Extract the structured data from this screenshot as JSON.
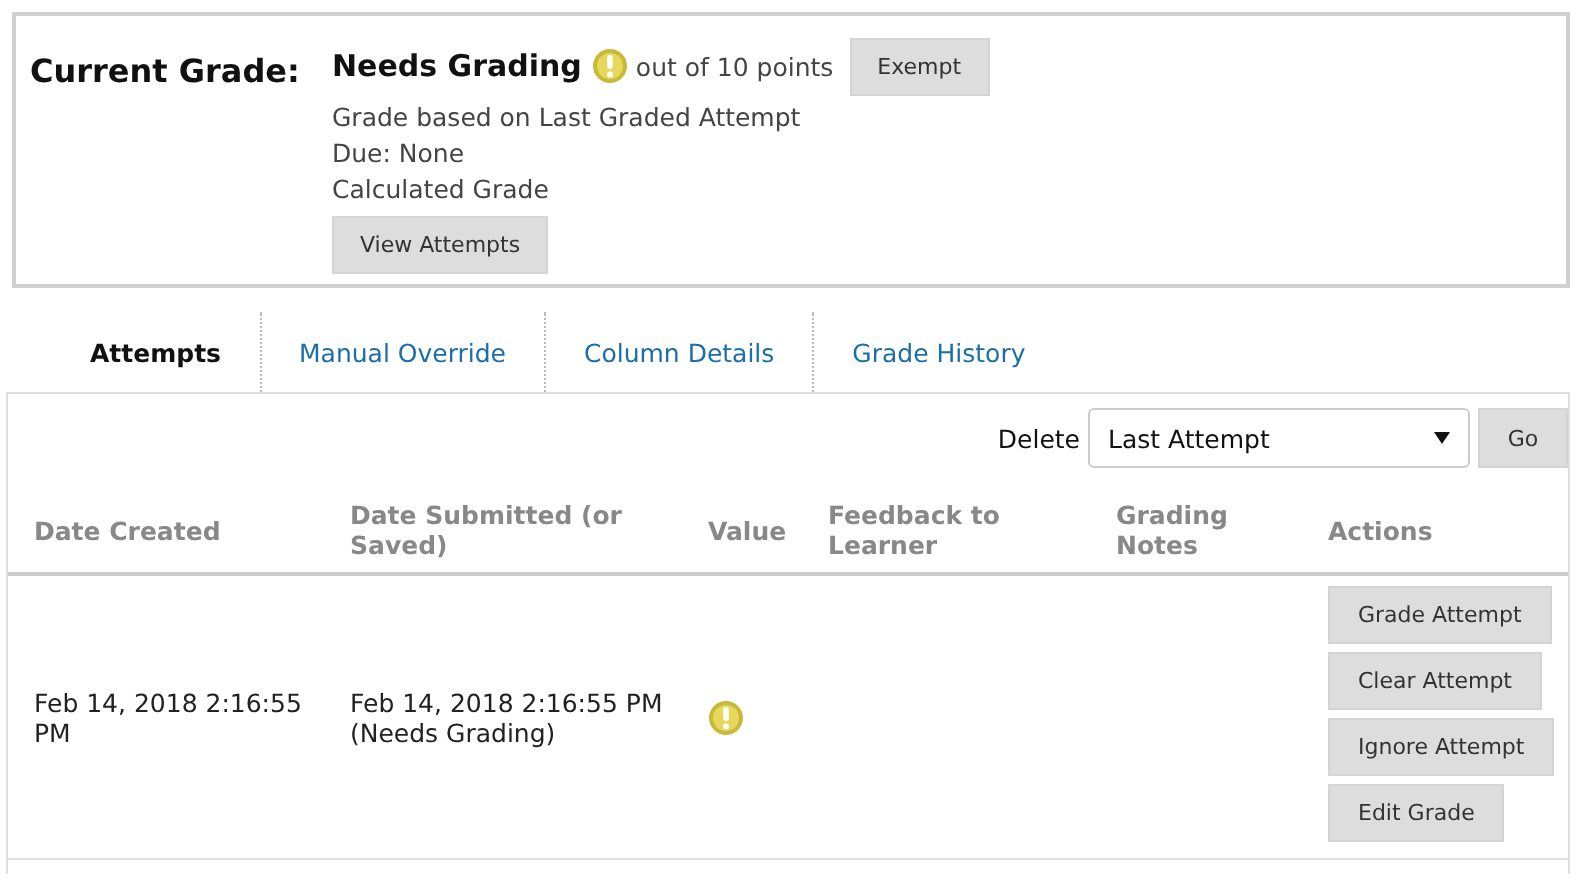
{
  "current_grade": {
    "label": "Current Grade:",
    "status": "Needs Grading",
    "status_icon": {
      "kind": "needs_grading"
    },
    "points": "out of 10 points",
    "exempt_button": "Exempt",
    "details": [
      "Grade based on Last Graded Attempt",
      "Due: None",
      "Calculated Grade"
    ],
    "view_button": "View Attempts"
  },
  "tabs": [
    {
      "label": "Attempts",
      "selected": true
    },
    {
      "label": "Manual Override",
      "selected": false
    },
    {
      "label": "Column Details",
      "selected": false
    },
    {
      "label": "Grade History",
      "selected": false
    }
  ],
  "delete": {
    "label": "Delete",
    "value": "Last Attempt",
    "button": "Go"
  },
  "table": {
    "columns": [
      "Date Created",
      "Date Submitted (or Saved)",
      "Value",
      "Feedback to Learner",
      "Grading Notes",
      "Actions"
    ],
    "rows": [
      {
        "date_created": "Feb 14, 2018 2:16:55 PM",
        "date_submitted": "Feb 14, 2018 2:16:55 PM",
        "submitted_note": "(Needs Grading)",
        "value": {
          "kind": "needs_grading"
        },
        "actions": [
          "Grade Attempt",
          "Clear Attempt",
          "Ignore Attempt",
          "Edit Grade"
        ]
      }
    ]
  }
}
